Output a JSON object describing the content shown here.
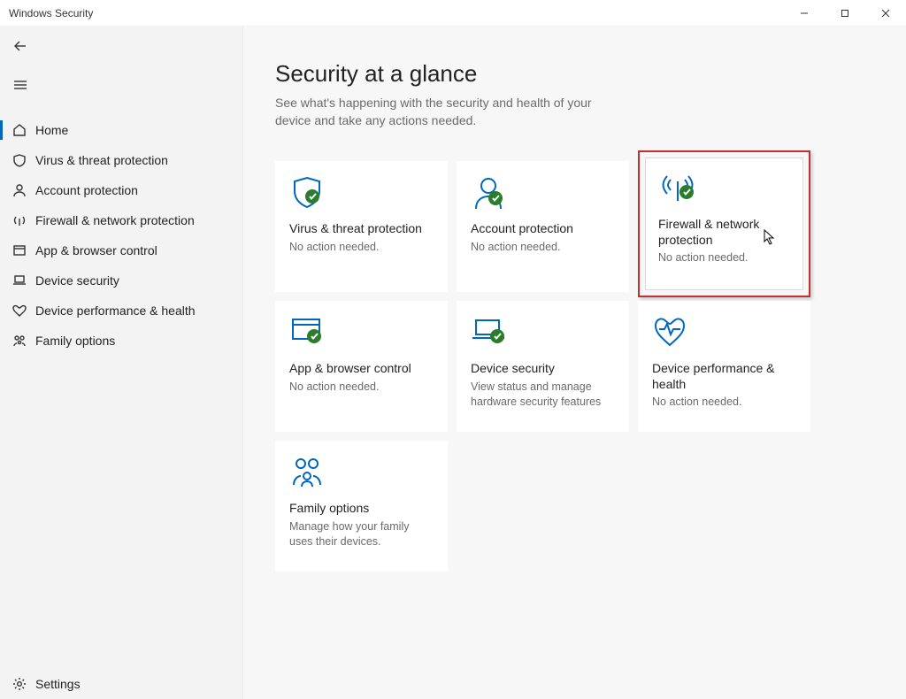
{
  "window": {
    "title": "Windows Security"
  },
  "sidebar": {
    "items": [
      {
        "label": "Home"
      },
      {
        "label": "Virus & threat protection"
      },
      {
        "label": "Account protection"
      },
      {
        "label": "Firewall & network protection"
      },
      {
        "label": "App & browser control"
      },
      {
        "label": "Device security"
      },
      {
        "label": "Device performance & health"
      },
      {
        "label": "Family options"
      }
    ],
    "settings_label": "Settings"
  },
  "main": {
    "heading": "Security at a glance",
    "subtitle": "See what's happening with the security and health of your device and take any actions needed.",
    "cards": [
      {
        "title": "Virus & threat protection",
        "subtitle": "No action needed."
      },
      {
        "title": "Account protection",
        "subtitle": "No action needed."
      },
      {
        "title": "Firewall & network protection",
        "subtitle": "No action needed."
      },
      {
        "title": "App & browser control",
        "subtitle": "No action needed."
      },
      {
        "title": "Device security",
        "subtitle": "View status and manage hardware security features"
      },
      {
        "title": "Device performance & health",
        "subtitle": "No action needed."
      },
      {
        "title": "Family options",
        "subtitle": "Manage how your family uses their devices."
      }
    ]
  },
  "highlight": {
    "card_index": 2,
    "color": "#c23030"
  }
}
